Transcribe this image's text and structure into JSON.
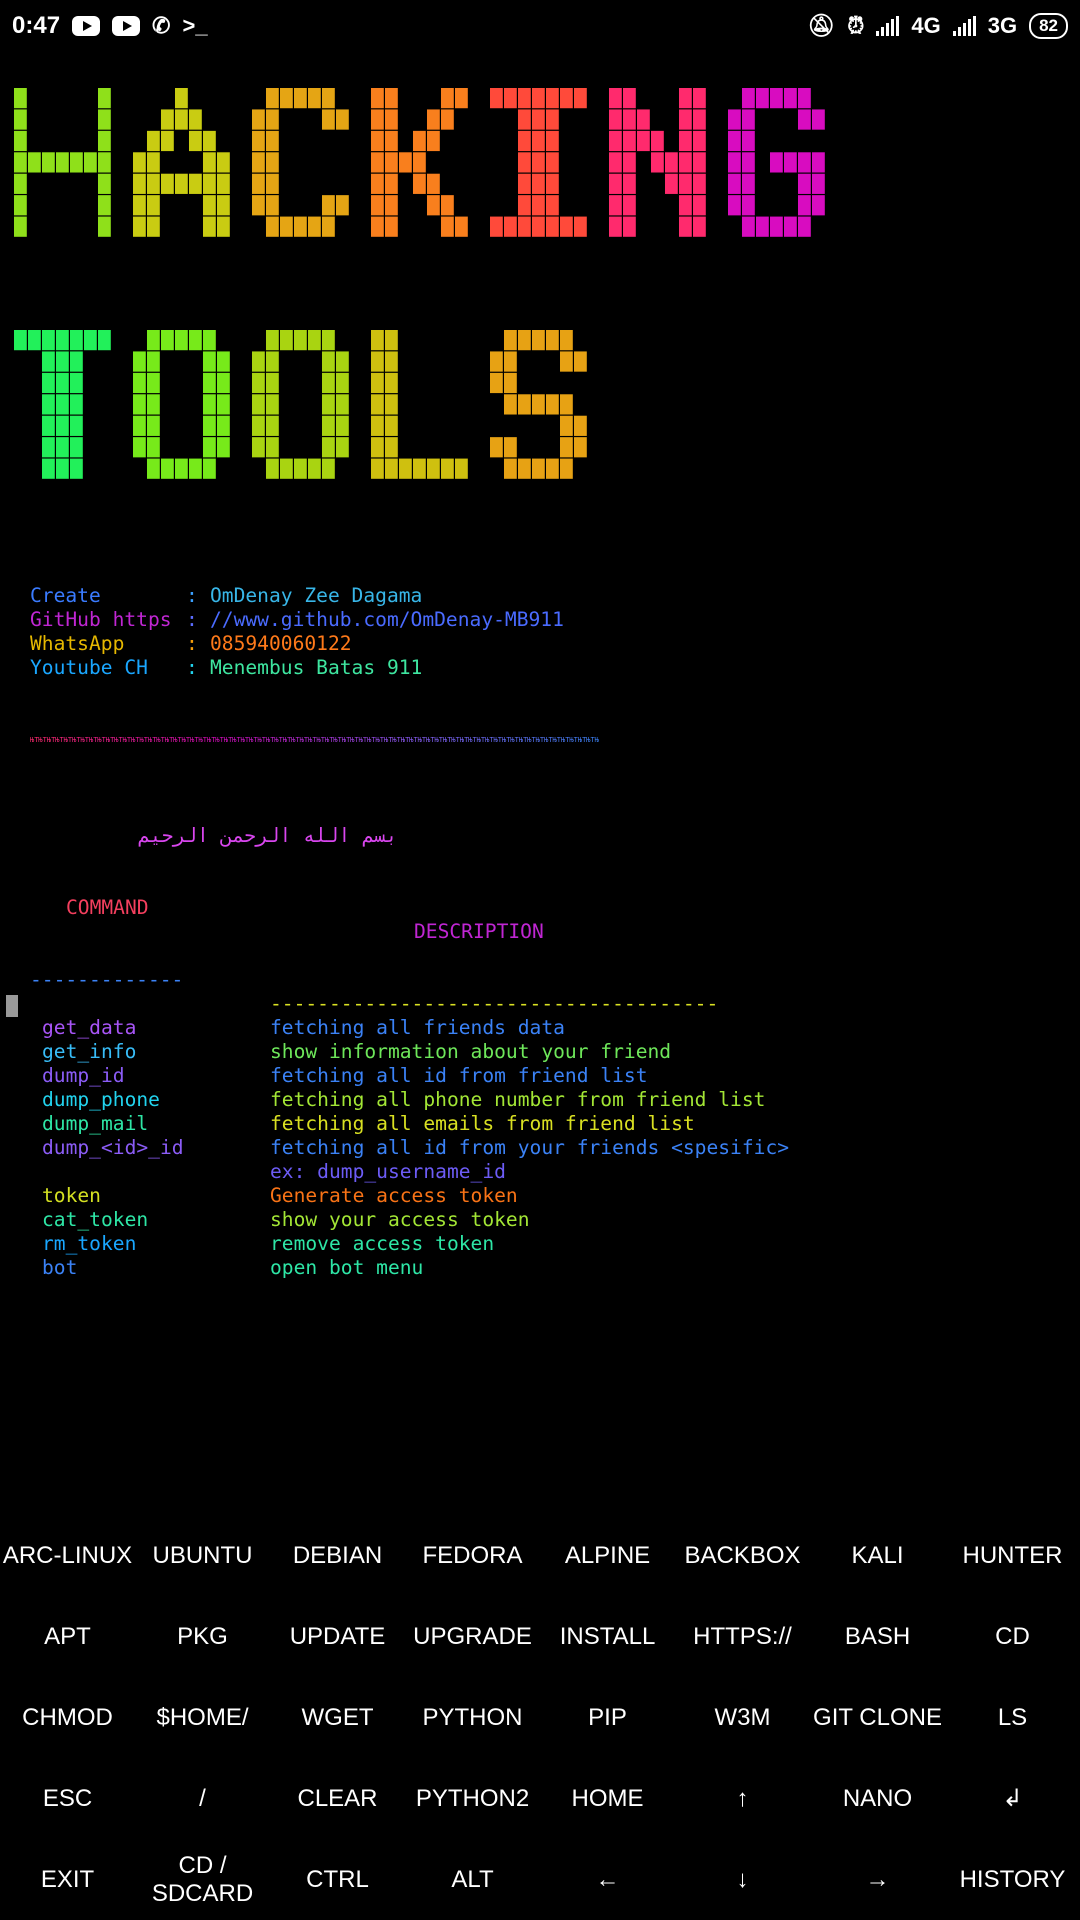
{
  "status_bar": {
    "time": "0:47",
    "net1": "4G",
    "net2": "3G",
    "battery": "82"
  },
  "banner": {
    "line1": "HACKING",
    "line2": "TOOLS",
    "colors1": [
      "#8fe01a",
      "#c9cc12",
      "#e5a514",
      "#f97f1d",
      "#ff4a3a",
      "#ff2a6d",
      "#d80cc0"
    ],
    "colors2": [
      "#22f05a",
      "#77ea1a",
      "#a9d411",
      "#cfc00f",
      "#e7a214"
    ]
  },
  "info": [
    {
      "label": "Create",
      "sep": ":",
      "value": "OmDenay Zee Dagama",
      "label_color": "#3a7bff",
      "sep_color": "#3aa0ff",
      "value_color": "#38b6e8"
    },
    {
      "label": "GitHub https",
      "sep": ":",
      "value": "//www.github.com/OmDenay-MB911",
      "label_color": "#c026d3",
      "sep_color": "#5b6cff",
      "value_color": "#4a6bff"
    },
    {
      "label": "WhatsApp",
      "sep": ":",
      "value": "085940060122",
      "label_color": "#e6b800",
      "sep_color": "#f59e0b",
      "value_color": "#ff7a1a"
    },
    {
      "label": "Youtube CH",
      "sep": ":",
      "value": "Menembus Batas 911",
      "label_color": "#1aa7ff",
      "sep_color": "#22d3ee",
      "value_color": "#3ee6a0"
    }
  ],
  "divider_text": "ЊТЊТЊТЊТЊТЊТЊТЊТЊТЊТЊТЊТЊТЊТЊТЊТЊТЊТЊТЊТЊТЊТЊТЊТЊТЊТЊТЊТЊТЊТЊТЊТЊТЊТЊТЊТЊТЊТЊТЊТЊТЊТЊТЊТЊТЊТЊТЊТЊТЊТЊТЊТЊТЊТЊТЊТЊТЊТЊТЊТЊТЊТЊТЊТЊТЊТЊТЊ",
  "basmala": "بسم الله الرحمن الرحيم",
  "headers": {
    "command": "COMMAND",
    "description": "DESCRIPTION",
    "dash_cmd": "-------------",
    "dash_desc": "--------------------------------------"
  },
  "commands": [
    {
      "cmd": "get_data",
      "desc": "fetching all friends data",
      "cc": "#a855f7",
      "dc": "#3b82f6"
    },
    {
      "cmd": "get_info",
      "desc": "show information about your friend",
      "cc": "#38bdf8",
      "dc": "#6ee75a"
    },
    {
      "cmd": "dump_id",
      "desc": "fetching all id from friend list",
      "cc": "#8b5cf6",
      "dc": "#3b82f6"
    },
    {
      "cmd": "dump_phone",
      "desc": "fetching all phone number from friend list",
      "cc": "#22d3ee",
      "dc": "#a3e635"
    },
    {
      "cmd": "dump_mail",
      "desc": "fetching all emails from friend list",
      "cc": "#2ee6a6",
      "dc": "#d9e022"
    },
    {
      "cmd": "dump_<id>_id",
      "desc": "fetching all id from your friends <spesific>",
      "cc": "#8b5cf6",
      "dc": "#3b82f6"
    },
    {
      "cmd": "",
      "desc": "ex: dump_username_id",
      "cc": "#8b5cf6",
      "dc": "#6d5cf6"
    },
    {
      "cmd": "token",
      "desc": "Generate access token",
      "cc": "#d4e022",
      "dc": "#f97316"
    },
    {
      "cmd": "cat_token",
      "desc": "show your access token",
      "cc": "#2ee6a6",
      "dc": "#a3e635"
    },
    {
      "cmd": "rm_token",
      "desc": "remove access token",
      "cc": "#1aa7ff",
      "dc": "#2ee6a6"
    },
    {
      "cmd": "bot",
      "desc": "open bot menu",
      "cc": "#3b82f6",
      "dc": "#2ee6a6"
    }
  ],
  "keys": [
    "ARC-LINUX",
    "UBUNTU",
    "DEBIAN",
    "FEDORA",
    "ALPINE",
    "BACKBOX",
    "KALI",
    "HUNTER",
    "APT",
    "PKG",
    "UPDATE",
    "UPGRADE",
    "INSTALL",
    "HTTPS://",
    "BASH",
    "CD",
    "CHMOD",
    "$HOME/",
    "WGET",
    "PYTHON",
    "PIP",
    "W3M",
    "GIT CLONE",
    "LS",
    "ESC",
    "/",
    "CLEAR",
    "PYTHON2",
    "HOME",
    "↑",
    "NANO",
    "↲",
    "EXIT",
    "CD /\nSDCARD",
    "CTRL",
    "ALT",
    "←",
    "↓",
    "→",
    "HISTORY"
  ]
}
